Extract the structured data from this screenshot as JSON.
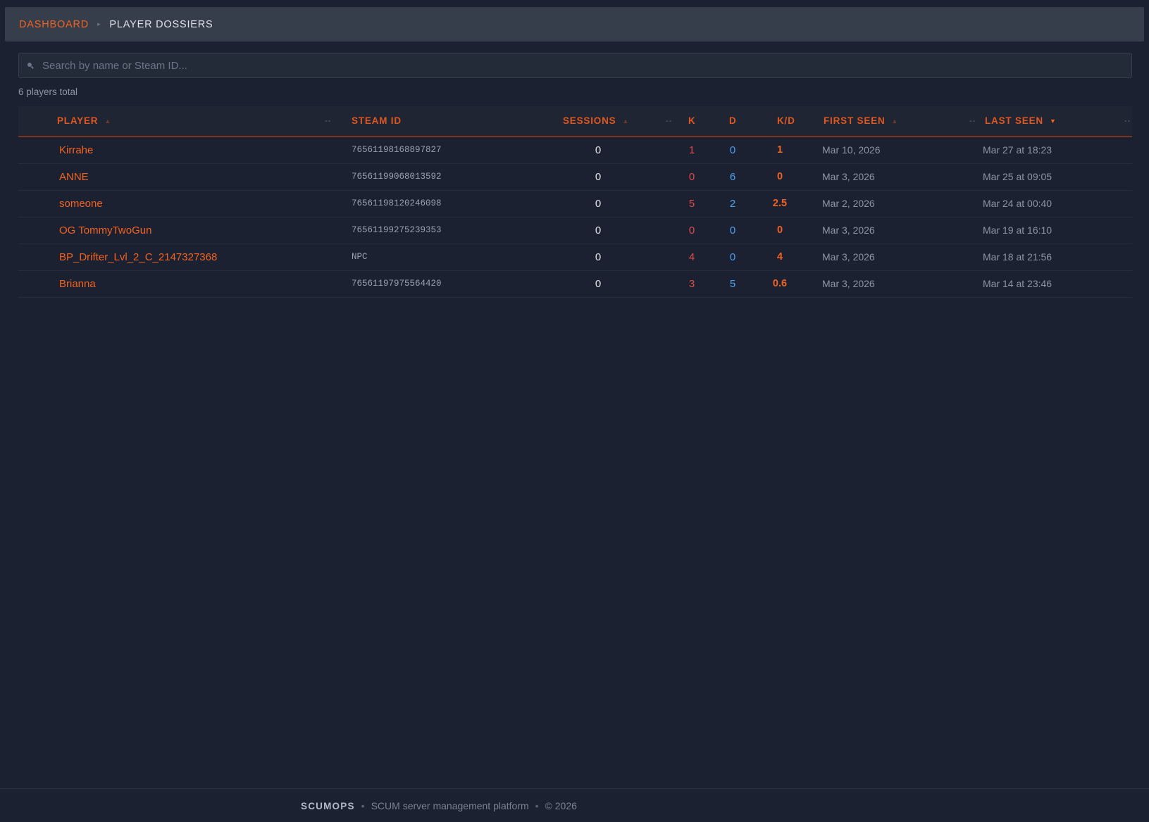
{
  "breadcrumb": {
    "root": "DASHBOARD",
    "separator": "▸",
    "current": "PLAYER DOSSIERS"
  },
  "search": {
    "placeholder": "Search by name or Steam ID...",
    "value": ""
  },
  "summary": {
    "count_text": "6 players total"
  },
  "table": {
    "columns": {
      "player": "PLAYER",
      "steam_id": "STEAM ID",
      "sessions": "SESSIONS",
      "k": "K",
      "d": "D",
      "kd": "K/D",
      "first_seen": "FIRST SEEN",
      "last_seen": "LAST SEEN"
    },
    "sort_indicators": {
      "asc": "▲",
      "desc": "▼",
      "resize": "--"
    },
    "active_sort": {
      "column": "last_seen",
      "direction": "desc"
    },
    "rows": [
      {
        "player": "Kirrahe",
        "steam_id": "76561198168897827",
        "sessions": "0",
        "k": "1",
        "d": "0",
        "kd": "1",
        "first_seen": "Mar 10, 2026",
        "last_seen": "Mar 27 at 18:23"
      },
      {
        "player": "ANNE",
        "steam_id": "76561199068013592",
        "sessions": "0",
        "k": "0",
        "d": "6",
        "kd": "0",
        "first_seen": "Mar 3, 2026",
        "last_seen": "Mar 25 at 09:05"
      },
      {
        "player": "someone",
        "steam_id": "76561198120246098",
        "sessions": "0",
        "k": "5",
        "d": "2",
        "kd": "2.5",
        "first_seen": "Mar 2, 2026",
        "last_seen": "Mar 24 at 00:40"
      },
      {
        "player": "OG TommyTwoGun",
        "steam_id": "76561199275239353",
        "sessions": "0",
        "k": "0",
        "d": "0",
        "kd": "0",
        "first_seen": "Mar 3, 2026",
        "last_seen": "Mar 19 at 16:10"
      },
      {
        "player": "BP_Drifter_Lvl_2_C_2147327368",
        "steam_id": "NPC",
        "sessions": "0",
        "k": "4",
        "d": "0",
        "kd": "4",
        "first_seen": "Mar 3, 2026",
        "last_seen": "Mar 18 at 21:56"
      },
      {
        "player": "Brianna",
        "steam_id": "76561197975564420",
        "sessions": "0",
        "k": "3",
        "d": "5",
        "kd": "0.6",
        "first_seen": "Mar 3, 2026",
        "last_seen": "Mar 14 at 23:46"
      }
    ]
  },
  "footer": {
    "brand": "SCUMOPS",
    "separator": "•",
    "tagline": "SCUM server management platform",
    "copyright": "© 2026"
  },
  "colors": {
    "accent": "#f26322",
    "kills": "#e24b4b",
    "deaths": "#4aa3f0",
    "background": "#1b2130",
    "topbar": "#363d4b"
  },
  "icons": {
    "search": "search-icon"
  }
}
